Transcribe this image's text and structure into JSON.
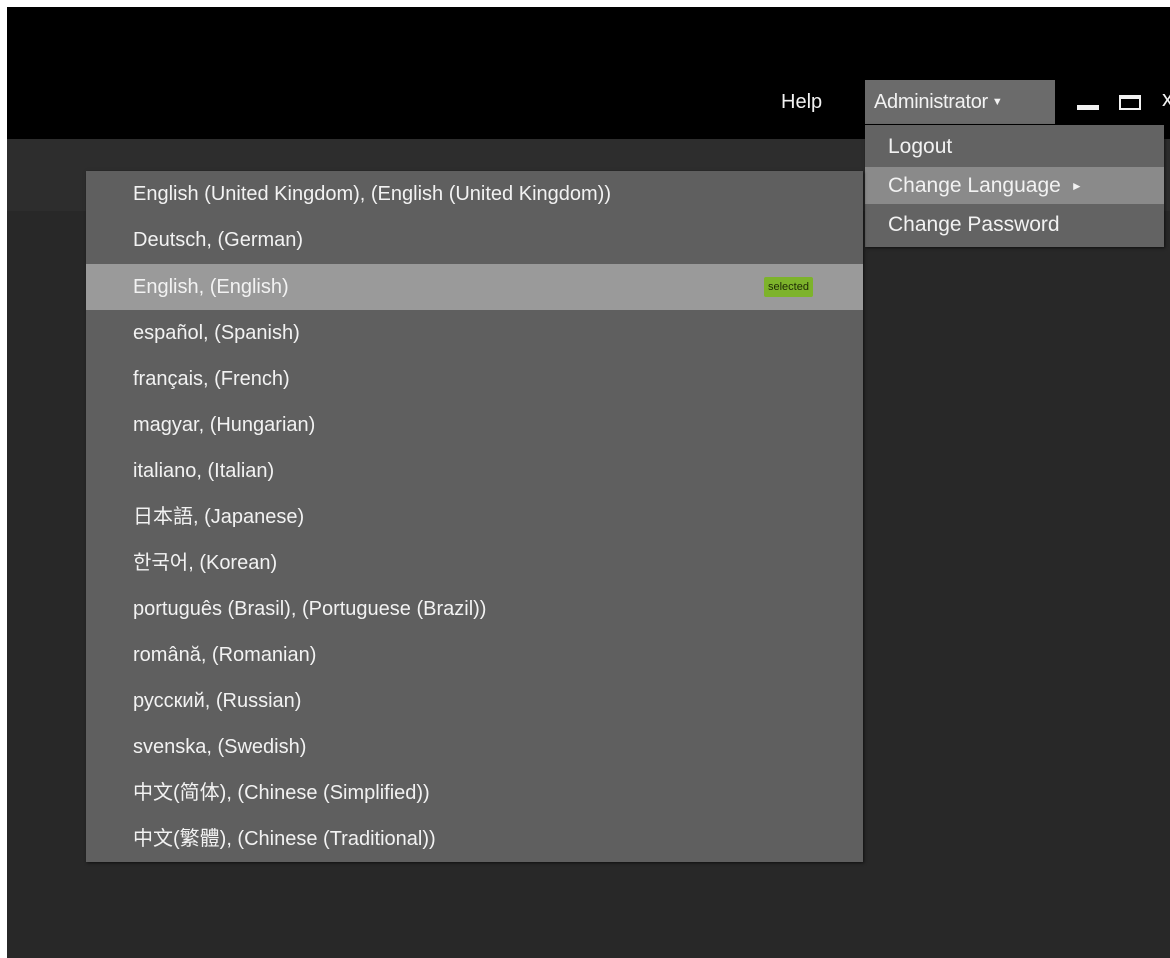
{
  "header": {
    "help_label": "Help",
    "user_label": "Administrator",
    "caret": "▼",
    "window_controls": [
      "minimize-icon",
      "maximize-icon",
      "close-icon"
    ],
    "close_glyph": "x"
  },
  "user_menu": {
    "items": [
      {
        "label": "Logout",
        "highlighted": false
      },
      {
        "label": "Change Language",
        "highlighted": true,
        "has_submenu": true,
        "arrow": "►"
      },
      {
        "label": "Change Password",
        "highlighted": false
      }
    ]
  },
  "language_menu": {
    "selected_badge": "selected",
    "selected_index": 2,
    "items": [
      "English (United Kingdom), (English (United Kingdom))",
      "Deutsch, (German)",
      "English, (English)",
      "español, (Spanish)",
      "français, (French)",
      "magyar, (Hungarian)",
      "italiano, (Italian)",
      "日本語, (Japanese)",
      "한국어, (Korean)",
      "português (Brasil), (Portuguese (Brazil))",
      "română, (Romanian)",
      "русский, (Russian)",
      "svenska, (Swedish)",
      "中文(简体), (Chinese (Simplified))",
      "中文(繁體), (Chinese (Traditional))"
    ]
  },
  "colors": {
    "titlebar": "#000000",
    "background": "#282828",
    "menu": "#5f5f5f",
    "selected_row": "#9a9a9a",
    "badge": "#7db32b"
  }
}
